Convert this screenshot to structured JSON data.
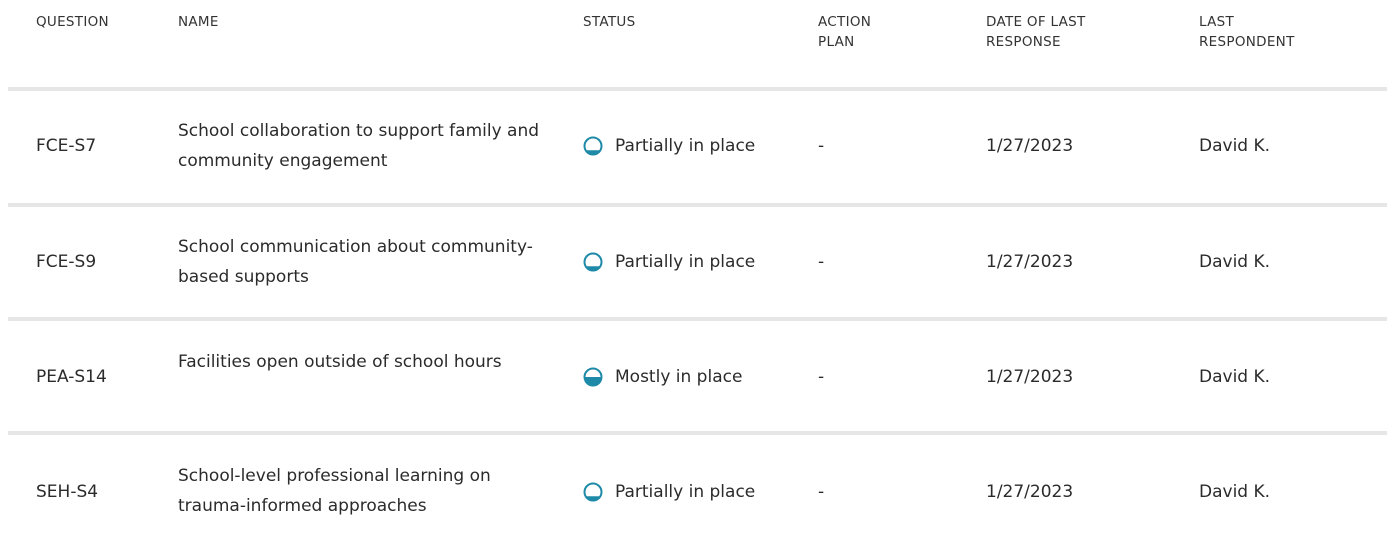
{
  "header": {
    "question": "QUESTION",
    "name": "NAME",
    "status": "STATUS",
    "action_plan": "ACTION\nPLAN",
    "date_of_last_response": "DATE OF LAST\nRESPONSE",
    "last_respondent": "LAST\nRESPONDENT"
  },
  "colors": {
    "status_icon": "#1e8aa8",
    "divider": "#e6e6e6"
  },
  "rows": [
    {
      "code": "FCE-S7",
      "name": "School collaboration to support family and community engagement",
      "status": "Partially in place",
      "status_icon": "partially-in-place-icon",
      "status_fill": 0.25,
      "action_plan": "-",
      "date": "1/27/2023",
      "respondent": "David K."
    },
    {
      "code": "FCE-S9",
      "name": "School communication about community-based supports",
      "status": "Partially in place",
      "status_icon": "partially-in-place-icon",
      "status_fill": 0.25,
      "action_plan": "-",
      "date": "1/27/2023",
      "respondent": "David K."
    },
    {
      "code": "PEA-S14",
      "name": "Facilities open outside of school hours",
      "status": "Mostly in place",
      "status_icon": "mostly-in-place-icon",
      "status_fill": 0.5,
      "action_plan": "-",
      "date": "1/27/2023",
      "respondent": "David K."
    },
    {
      "code": "SEH-S4",
      "name": "School-level professional learning on trauma-informed approaches",
      "status": "Partially in place",
      "status_icon": "partially-in-place-icon",
      "status_fill": 0.25,
      "action_plan": "-",
      "date": "1/27/2023",
      "respondent": "David K."
    }
  ]
}
